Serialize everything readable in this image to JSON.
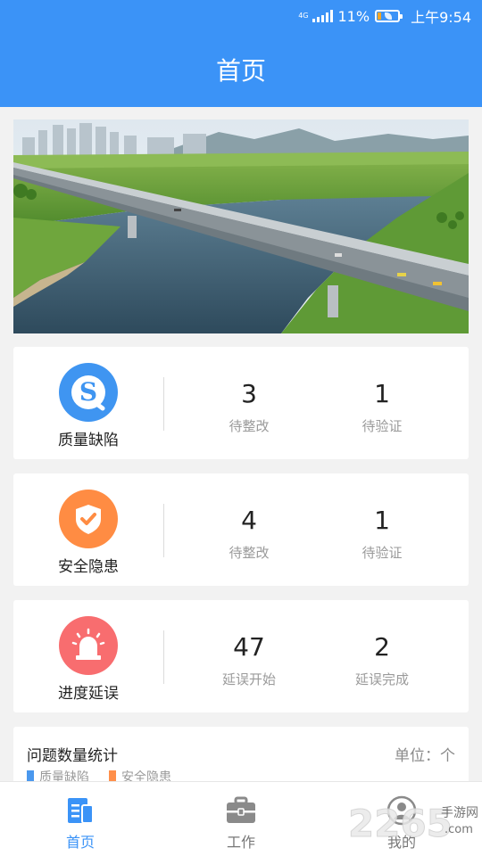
{
  "status_bar": {
    "network": "4G",
    "battery": "11%",
    "time": "上午9:54"
  },
  "header": {
    "title": "首页"
  },
  "banner": {
    "icon": "bridge-photo"
  },
  "cards": [
    {
      "name": "质量缺陷",
      "icon": "quality-s-icon",
      "color": "#3f95f1",
      "stats": [
        {
          "value": "3",
          "label": "待整改"
        },
        {
          "value": "1",
          "label": "待验证"
        }
      ]
    },
    {
      "name": "安全隐患",
      "icon": "shield-check-icon",
      "color": "#ff8c43",
      "stats": [
        {
          "value": "4",
          "label": "待整改"
        },
        {
          "value": "1",
          "label": "待验证"
        }
      ]
    },
    {
      "name": "进度延误",
      "icon": "alarm-light-icon",
      "color": "#f86d6f",
      "stats": [
        {
          "value": "47",
          "label": "延误开始"
        },
        {
          "value": "2",
          "label": "延误完成"
        }
      ]
    }
  ],
  "statistics": {
    "title": "问题数量统计",
    "unit": "单位：个",
    "legend": [
      {
        "label": "质量缺陷",
        "color": "#4a98ee"
      },
      {
        "label": "安全隐患",
        "color": "#ff8f4a"
      }
    ]
  },
  "tabs": [
    {
      "label": "首页",
      "icon": "home-doc-icon",
      "active": true
    },
    {
      "label": "工作",
      "icon": "toolbox-icon",
      "active": false
    },
    {
      "label": "我的",
      "icon": "person-icon",
      "active": false
    }
  ],
  "watermark": {
    "number": "2265",
    "text": "手游网",
    "domain": ".com"
  },
  "colors": {
    "primary": "#3b93f7",
    "background": "#f2f2f2"
  }
}
